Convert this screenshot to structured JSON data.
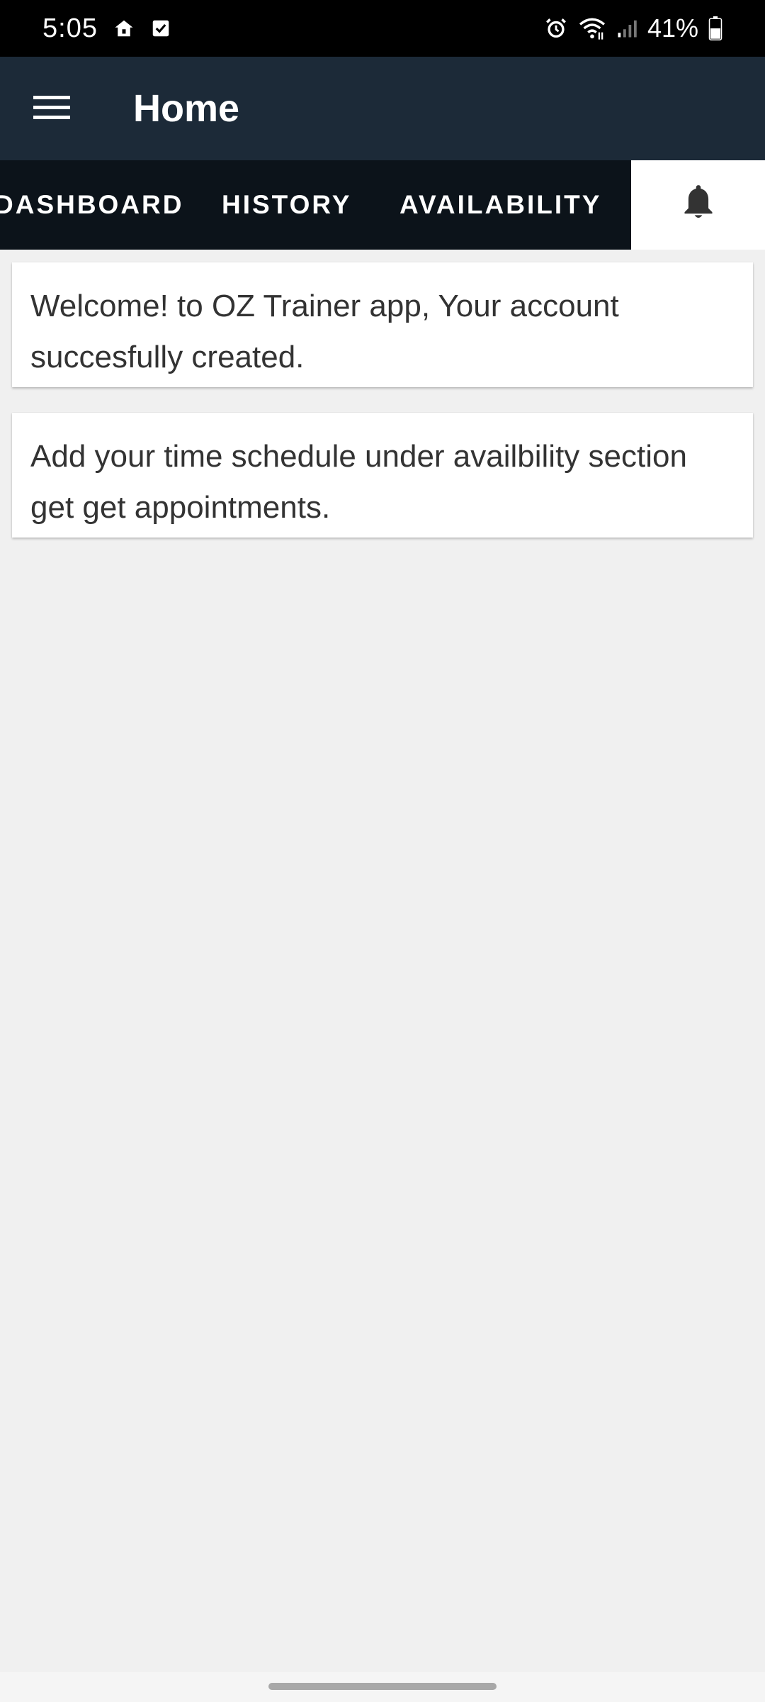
{
  "status_bar": {
    "time": "5:05",
    "battery": "41%",
    "icons": [
      "home-lock-icon",
      "checkbox-icon",
      "alarm-icon",
      "wifi-icon",
      "signal-icon",
      "battery-icon"
    ]
  },
  "app_bar": {
    "title": "Home",
    "menu_icon": "hamburger-menu-icon"
  },
  "tabs": [
    {
      "label": "DASHBOARD",
      "selected": false
    },
    {
      "label": "HISTORY",
      "selected": false
    },
    {
      "label": "AVAILABILITY",
      "selected": false
    },
    {
      "label": "",
      "icon": "bell-icon",
      "selected": true
    }
  ],
  "notifications": [
    {
      "text": "Welcome! to OZ Trainer app, Your account succesfully created."
    },
    {
      "text": "Add your time schedule under availbility section get get appointments."
    }
  ],
  "colors": {
    "app_bar": "#1c2a38",
    "tab_bar": "#0c131a",
    "selected_tab": "#ffffff",
    "background": "#f0f0f0",
    "text": "#333333"
  }
}
